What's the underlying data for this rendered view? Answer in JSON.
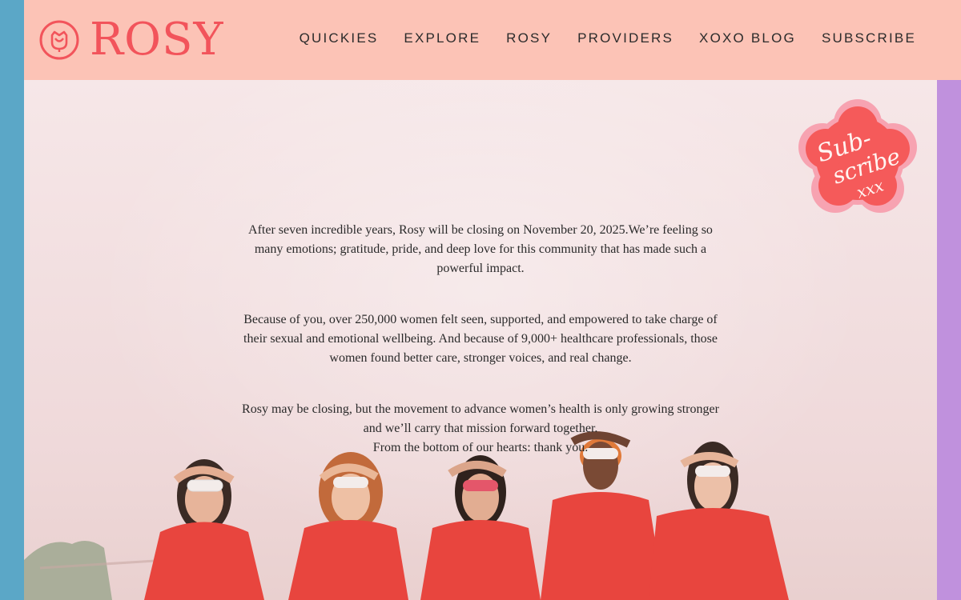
{
  "brand": {
    "name": "ROSY",
    "logo_icon": "rose-icon",
    "color": "#f2545b"
  },
  "nav": {
    "items": [
      {
        "label": "QUICKIES"
      },
      {
        "label": "EXPLORE"
      },
      {
        "label": "ROSY"
      },
      {
        "label": "PROVIDERS"
      },
      {
        "label": "XOXO BLOG"
      },
      {
        "label": "SUBSCRIBE"
      }
    ]
  },
  "message": {
    "p1": "After seven incredible years, Rosy will be closing on November 20, 2025.We’re feeling so many emotions; gratitude, pride, and deep love for this community that has made such a powerful impact.",
    "p2": "Because of you, over 250,000 women felt seen, supported, and empowered to take charge of their sexual and emotional wellbeing. And because of 9,000+ healthcare professionals, those women found better care, stronger voices, and real change.",
    "p3_line1": "Rosy may be closing, but the movement to advance women’s health is only growing stronger and we’ll carry that mission forward together.",
    "p3_line2": "From the bottom of our hearts: thank you."
  },
  "sticker": {
    "line1": "Sub-",
    "line2": "scribe",
    "line3": "xxx",
    "icon": "subscribe-flower-sticker"
  },
  "colors": {
    "header_bg": "#fcc3b6",
    "left_bar": "#5ba7c7",
    "right_bar": "#c091dd",
    "sticker_fill": "#f55a5a",
    "sticker_border": "#f7a3b1",
    "outfit_red": "#e8453e"
  }
}
